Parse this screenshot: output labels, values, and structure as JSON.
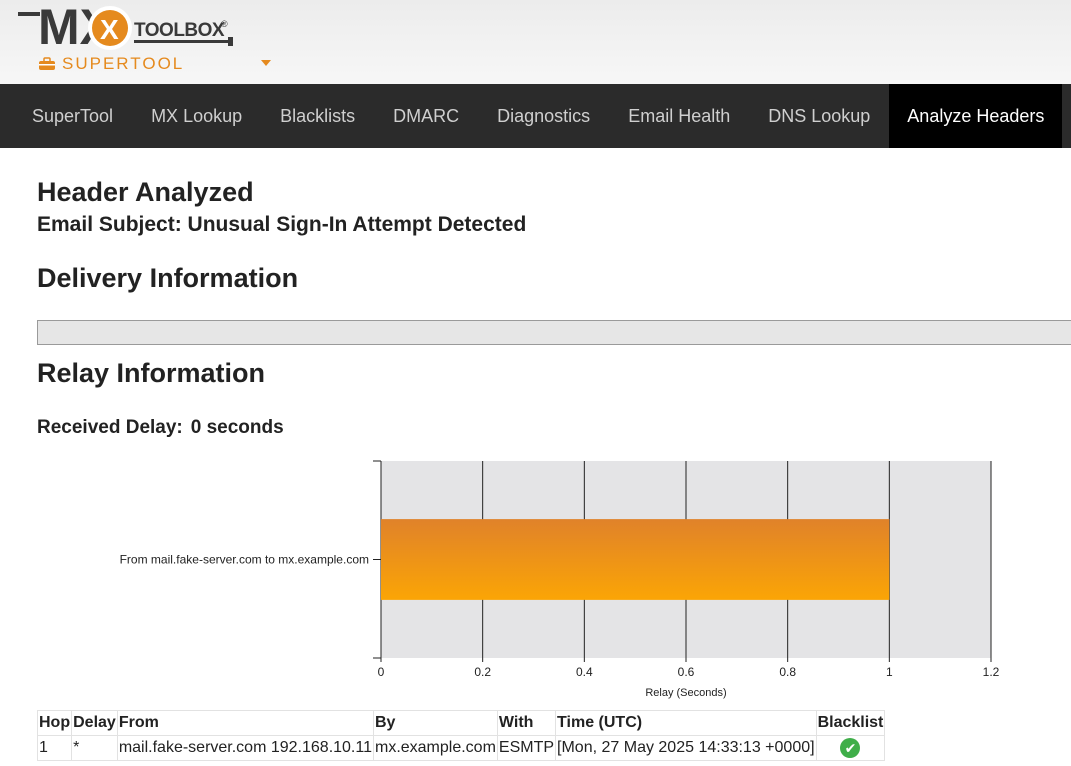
{
  "header": {
    "logo_mx": "MX",
    "logo_toolbox": "TOOLBOX",
    "logo_registered": "®",
    "supertool_label": "SUPERTOOL",
    "accent_color": "#e58a1e"
  },
  "nav": {
    "items": [
      "SuperTool",
      "MX Lookup",
      "Blacklists",
      "DMARC",
      "Diagnostics",
      "Email Health",
      "DNS Lookup",
      "Analyze Headers"
    ],
    "active": "Analyze Headers"
  },
  "main": {
    "header_title": "Header Analyzed",
    "email_subject": "Email Subject: Unusual Sign-In Attempt Detected",
    "delivery_title": "Delivery Information",
    "relay_title": "Relay Information",
    "received_delay_label": "Received Delay:",
    "received_delay_value": "0 seconds"
  },
  "chart_data": {
    "type": "bar",
    "orientation": "horizontal",
    "categories": [
      "From mail.fake-server.com to mx.example.com"
    ],
    "values": [
      1
    ],
    "xlabel": "Relay (Seconds)",
    "ylabel": "",
    "xlim": [
      0,
      1.2
    ],
    "xticks": [
      "0",
      "0.2",
      "0.4",
      "0.6",
      "0.8",
      "1",
      "1.2"
    ],
    "bar_color": "#f5a00a",
    "grid": true
  },
  "table": {
    "columns": [
      "Hop",
      "Delay",
      "From",
      "By",
      "With",
      "Time (UTC)",
      "Blacklist"
    ],
    "rows": [
      {
        "hop": "1",
        "delay": "*",
        "from": "mail.fake-server.com 192.168.10.11",
        "by": "mx.example.com",
        "with": "ESMTP",
        "time": "[Mon, 27 May 2025 14:33:13 +0000]",
        "blacklist": "check-icon"
      }
    ]
  }
}
